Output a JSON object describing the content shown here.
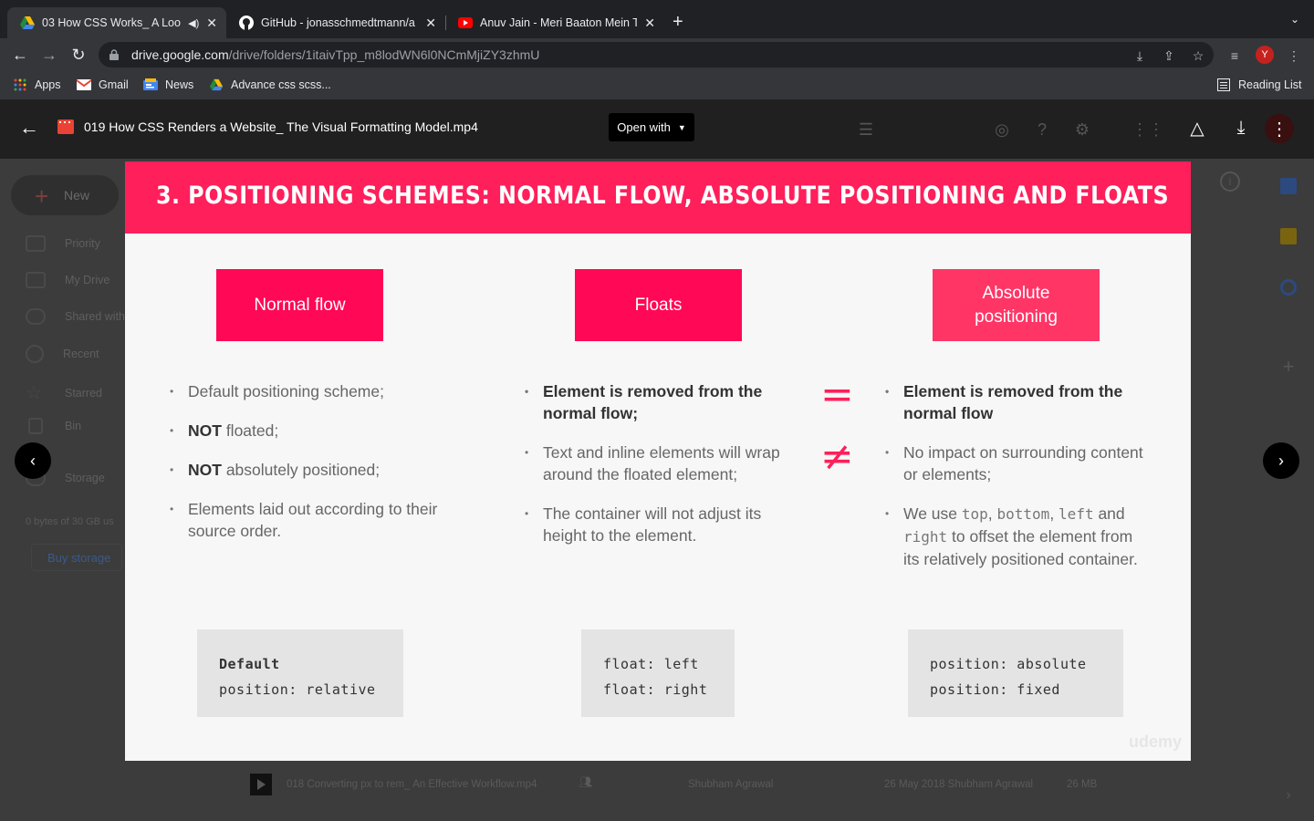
{
  "tabs": [
    {
      "title": "03 How CSS Works_ A Loo",
      "active": true
    },
    {
      "title": "GitHub - jonasschmedtmann/a",
      "active": false
    },
    {
      "title": "Anuv Jain - Meri Baaton Mein T",
      "active": false
    }
  ],
  "address": {
    "domain": "drive.google.com",
    "path": "/drive/folders/1itaivTpp_m8lodWN6l0NCmMjiZY3zhmU"
  },
  "profile_initial": "Y",
  "bookmarks": [
    "Apps",
    "Gmail",
    "News",
    "Advance css scss..."
  ],
  "reading_list": "Reading List",
  "viewer": {
    "file_title": "019 How CSS Renders a Website_ The Visual Formatting Model.mp4",
    "open_with": "Open with"
  },
  "drive_bg": {
    "new_label": "New",
    "sidebar": [
      "Priority",
      "My Drive",
      "Shared with",
      "Recent",
      "Starred",
      "Bin",
      "Storage"
    ],
    "storage_text": "0 bytes of 30 GB us",
    "buy_storage": "Buy storage",
    "file_row": {
      "name": "018 Converting px to rem_ An Effective Workflow.mp4",
      "owner": "Shubham Agrawal",
      "modified": "26 May 2018 Shubham Agrawal",
      "size": "26 MB"
    }
  },
  "slide": {
    "title": "3. POSITIONING SCHEMES: NORMAL FLOW, ABSOLUTE POSITIONING AND FLOATS",
    "watermark": "udemy",
    "schemes": [
      {
        "label": "Normal flow"
      },
      {
        "label": "Floats"
      },
      {
        "label_line1": "Absolute",
        "label_line2": "positioning"
      }
    ],
    "normal_flow": {
      "b1": "Default positioning scheme;",
      "b2_bold": "NOT",
      "b2_rest": " floated;",
      "b3_bold": "NOT",
      "b3_rest": " absolutely positioned;",
      "b4": "Elements laid out according to their source order."
    },
    "floats": {
      "b1": "Element is removed from the normal flow;",
      "b2": "Text and inline elements will wrap around the floated element;",
      "b3": "The container will not adjust its height to the element."
    },
    "absolute": {
      "b1": "Element is removed from the normal flow",
      "b2": "No impact on surrounding content or elements;",
      "b3_pre": "We use ",
      "b3_kw1": "top",
      "b3_kw2": "bottom",
      "b3_kw3": "left",
      "b3_and": " and ",
      "b3_kw4": "right",
      "b3_post": " to offset the element from its relatively positioned container."
    },
    "symbols": {
      "equal": "=",
      "not_equal": "≠"
    },
    "code": {
      "normal_line1": "Default",
      "normal_line2": "position: relative",
      "floats_line1": "float: left",
      "floats_line2": "float: right",
      "abs_line1": "position: absolute",
      "abs_line2": "position: fixed"
    }
  }
}
